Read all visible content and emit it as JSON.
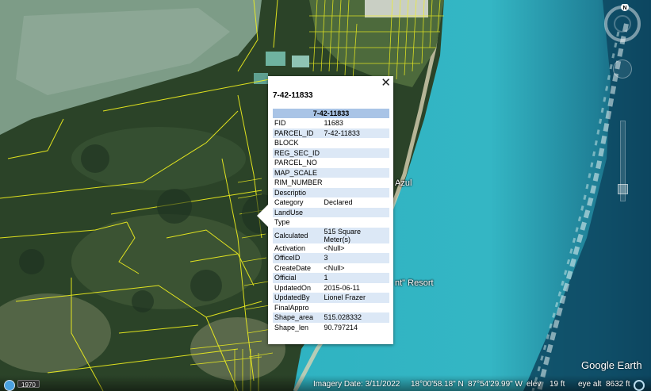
{
  "map": {
    "labels": {
      "azul": "Azul",
      "resort": "nt\" Resort"
    },
    "colors": {
      "parcel_lines": "#f2f21e",
      "lagoon": "#7d9c87",
      "reef": "#34b6c4",
      "ocean": "#0d4660",
      "forest": "#2b4328"
    }
  },
  "popup": {
    "title": "7-42-11833",
    "table_header": "7-42-11833",
    "close_icon": "✕",
    "rows": [
      {
        "key": "FID",
        "value": "11683"
      },
      {
        "key": "PARCEL_ID",
        "value": "7-42-11833"
      },
      {
        "key": "BLOCK",
        "value": ""
      },
      {
        "key": "REG_SEC_ID",
        "value": ""
      },
      {
        "key": "PARCEL_NO",
        "value": ""
      },
      {
        "key": "MAP_SCALE",
        "value": ""
      },
      {
        "key": "RIM_NUMBER",
        "value": ""
      },
      {
        "key": "Descriptio",
        "value": ""
      },
      {
        "key": "Category",
        "value": "Declared"
      },
      {
        "key": "LandUse",
        "value": ""
      },
      {
        "key": "Type",
        "value": ""
      },
      {
        "key": "Calculated",
        "value": "515 Square Meter(s)"
      },
      {
        "key": "Activation",
        "value": "<Null>"
      },
      {
        "key": "OfficeID",
        "value": "3"
      },
      {
        "key": "CreateDate",
        "value": "<Null>"
      },
      {
        "key": "Official",
        "value": "1"
      },
      {
        "key": "UpdatedOn",
        "value": "2015-06-11"
      },
      {
        "key": "UpdatedBy",
        "value": "Lionel Frazer"
      },
      {
        "key": "FinalAppro",
        "value": ""
      },
      {
        "key": "Shape_area",
        "value": "515.028332"
      },
      {
        "key": "Shape_len",
        "value": "90.797214"
      }
    ]
  },
  "nav": {
    "compass_north": "N"
  },
  "status": {
    "year": "1970",
    "imagery_date": "Imagery Date: 3/11/2022",
    "latitude": "18°00'58.18\" N",
    "longitude": "87°54'29.99\" W",
    "elev_label": "elev",
    "elev_value": "19 ft",
    "eye_alt_label": "eye alt",
    "eye_alt_value": "8632 ft"
  },
  "logo": "Google Earth"
}
